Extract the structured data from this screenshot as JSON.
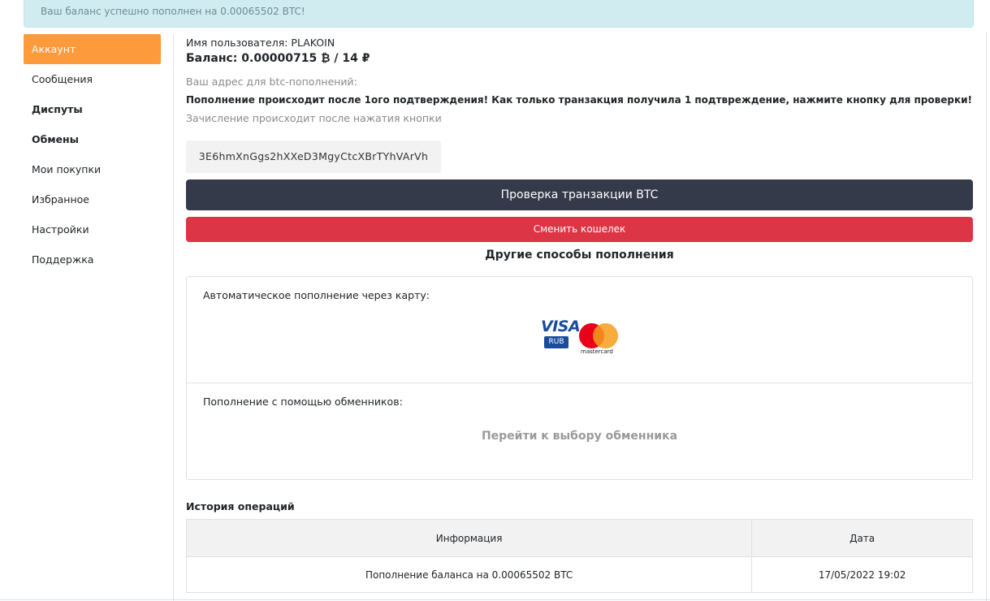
{
  "alert": {
    "text": "Ваш баланс успешно пополнен на 0.00065502 BTC!"
  },
  "sidebar": {
    "items": [
      {
        "label": "Аккаунт"
      },
      {
        "label": "Сообщения"
      },
      {
        "label": "Диспуты"
      },
      {
        "label": "Обмены"
      },
      {
        "label": "Мои покупки"
      },
      {
        "label": "Избранное"
      },
      {
        "label": "Настройки"
      },
      {
        "label": "Поддержка"
      }
    ]
  },
  "account": {
    "username": "Имя пользователя: PLAKOIN",
    "balance": "Баланс: 0.00000715 ₿ / 14 ₽",
    "address_label": "Ваш адрес для btc-пополнений:",
    "notice": "Пополнение происходит после 1ого подтверждения! Как только транзакция получила 1 подтвреждение, нажмите кнопку для проверки!",
    "notice2": "Зачисление происходит после нажатия кнопки",
    "btc_address": "3E6hmXnGgs2hXXeD3MgyCtcXBrTYhVArVh",
    "check_button": "Проверка транзакции BTC",
    "change_wallet_button": "Сменить кошелек"
  },
  "other_methods": {
    "title": "Другие способы пополнения",
    "card_label": "Автоматическое пополнение через карту:",
    "visa": "VISA",
    "rub": "RUB",
    "mastercard": "mastercard",
    "exchange_label": "Пополнение с помощью обменников:",
    "exchange_link": "Перейти к выбору обменника"
  },
  "history": {
    "title": "История операций",
    "columns": [
      "Информация",
      "Дата"
    ],
    "rows": [
      {
        "info": "Пополнение баланса на 0.00065502 BTC",
        "date": "17/05/2022 19:02"
      }
    ]
  },
  "colors": {
    "active_item": "#fd9a3c",
    "check_button": "#343a4a",
    "change_button": "#dc3545",
    "alert_bg": "#d1ecf1"
  }
}
